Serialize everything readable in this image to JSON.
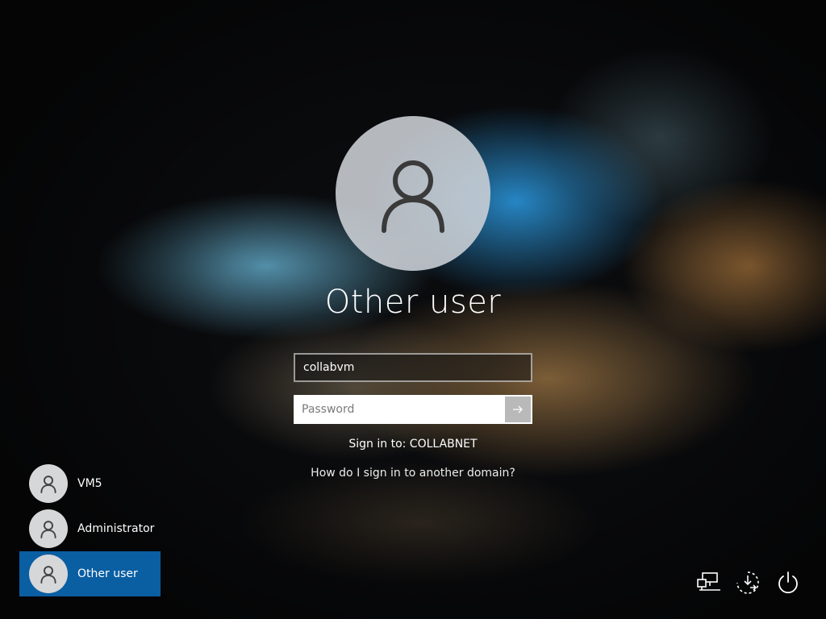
{
  "login": {
    "display_name": "Other user",
    "username_value": "collabvm",
    "password_placeholder": "Password",
    "sign_in_to": "Sign in to: COLLABNET",
    "domain_help": "How do I sign in to another domain?"
  },
  "users": [
    {
      "name": "VM5",
      "selected": false
    },
    {
      "name": "Administrator",
      "selected": false
    },
    {
      "name": "Other user",
      "selected": true
    }
  ],
  "tray": {
    "icons": [
      "network-icon",
      "ease-of-access-icon",
      "power-icon"
    ]
  },
  "colors": {
    "selected_user_bg": "#0a5ea2",
    "text": "#ffffff"
  }
}
